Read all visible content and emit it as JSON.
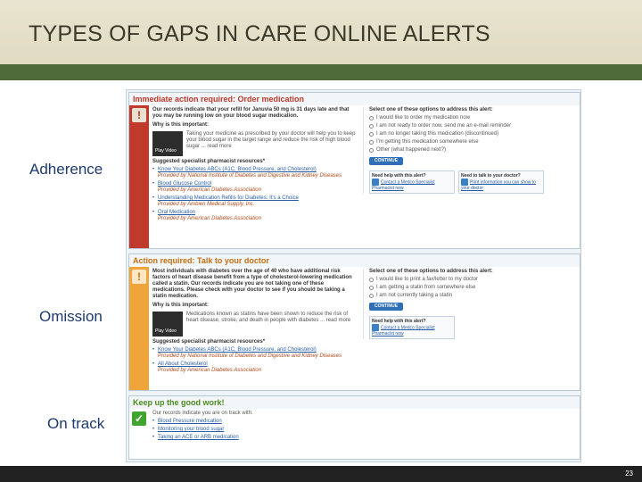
{
  "slide": {
    "title": "TYPES OF GAPS IN CARE ONLINE ALERTS",
    "page_number": "23",
    "labels": {
      "adherence": "Adherence",
      "omission": "Omission",
      "on_track": "On track"
    },
    "colors": {
      "title_band": "#e3ddc5",
      "stripe": "#4f6b3a",
      "label_text": "#1d3a6e",
      "footer": "#222222"
    }
  },
  "alerts": [
    {
      "header": "Immediate action required: Order medication",
      "status": "red",
      "icon": "exclamation-icon",
      "message": "Our records indicate that your refill for Januvia 50 mg is 31 days late and that you may be running low on your blood sugar medication.",
      "why_heading": "Why is this important:",
      "why_text": "Taking your medicine as prescribed by your doctor will help you to keep your blood sugar in the target range and reduce the risk of high blood sugar ... read more",
      "video_label": "Play Video",
      "resources_heading": "Suggested specialist pharmacist resources*",
      "resources": [
        {
          "title": "Know Your Diabetes ABCs (A1C, Blood Pressure, and Cholesterol)",
          "source": "Provided by National Institute of Diabetes and Digestive and Kidney Diseases"
        },
        {
          "title": "Blood Glucose Control",
          "source": "Provided by American Diabetes Association"
        },
        {
          "title": "Understanding Medication Refills for Diabetes: It's a Choice",
          "source": "Provided by Ambien Medical Supply, Inc."
        },
        {
          "title": "Oral Medication",
          "source": "Provided by American Diabetes Association"
        }
      ],
      "options_heading": "Select one of these options to address this alert:",
      "options": [
        "I would like to order my medication now",
        "I am not ready to order now, send me an e-mail reminder",
        "I am no longer taking this medication (discontinued)",
        "I'm getting this medication somewhere else",
        "Other (what happened next?)"
      ],
      "continue_label": "CONTINUE",
      "help_heading": "Need help with this alert?",
      "help_text": "Contact a Medco Specialist Pharmacist now",
      "tell_heading": "Need to talk to your doctor?",
      "tell_text": "Print information you can show to your doctor"
    },
    {
      "header": "Action required: Talk to your doctor",
      "status": "orange",
      "icon": "exclamation-icon",
      "message": "Most individuals with diabetes over the age of 40 who have additional risk factors of heart disease benefit from a type of cholesterol-lowering medication called a statin. Our records indicate you are not taking one of these medications. Please check with your doctor to see if you should be taking a statin medication.",
      "why_heading": "Why is this important:",
      "why_text": "Medications known as statins have been shown to reduce the risk of heart disease, stroke, and death in people with diabetes ... read more",
      "video_label": "Play Video",
      "resources_heading": "Suggested specialist pharmacist resources*",
      "resources": [
        {
          "title": "Know Your Diabetes ABCs (A1C, Blood Pressure, and Cholesterol)",
          "source": "Provided by National Institute of Diabetes and Digestive and Kidney Diseases"
        },
        {
          "title": "All About Cholesterol",
          "source": "Provided by American Diabetes Association"
        }
      ],
      "options_heading": "Select one of these options to address this alert:",
      "options": [
        "I would like to print a fax/letter to my doctor",
        "I am getting a statin from somewhere else",
        "I am not currently taking a statin"
      ],
      "continue_label": "CONTINUE",
      "help_heading": "Need help with this alert?",
      "help_text": "Contact a Medco Specialist Pharmacist now"
    },
    {
      "header": "Keep up the good work!",
      "status": "green",
      "icon": "check-icon",
      "message": "Our records indicate you are on track with:",
      "items": [
        "Blood Pressure medication",
        "Monitoring your blood sugar",
        "Taking an ACE or ARB medication"
      ]
    }
  ]
}
